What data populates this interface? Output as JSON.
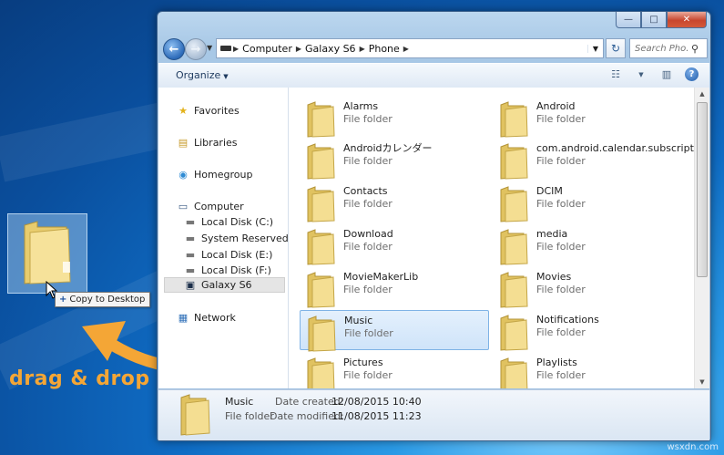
{
  "desktop": {
    "tooltip": "Copy to Desktop",
    "tooltip_icon": "plus-icon",
    "overlay_label": "drag & drop",
    "overlay_color": "#f4a636",
    "watermark": "wsxdn.com"
  },
  "window": {
    "caption_buttons": {
      "minimize": "—",
      "maximize": "□",
      "close": "✕"
    },
    "breadcrumb": [
      "Computer",
      "Galaxy S6",
      "Phone"
    ],
    "search_placeholder": "Search Pho...",
    "toolbar": {
      "organize": "Organize"
    }
  },
  "nav": {
    "favorites": "Favorites",
    "libraries": "Libraries",
    "homegroup": "Homegroup",
    "computer": "Computer",
    "drives": [
      "Local Disk (C:)",
      "System Reserved (D:)",
      "Local Disk (E:)",
      "Local Disk (F:)",
      "Galaxy S6"
    ],
    "network": "Network"
  },
  "folders": [
    {
      "name": "Alarms",
      "type": "File folder"
    },
    {
      "name": "Android",
      "type": "File folder"
    },
    {
      "name": "Androidカレンダー",
      "type": "File folder"
    },
    {
      "name": "com.android.calendar.subscription.a",
      "type": "File folder"
    },
    {
      "name": "Contacts",
      "type": "File folder"
    },
    {
      "name": "DCIM",
      "type": "File folder"
    },
    {
      "name": "Download",
      "type": "File folder"
    },
    {
      "name": "media",
      "type": "File folder"
    },
    {
      "name": "MovieMakerLib",
      "type": "File folder"
    },
    {
      "name": "Movies",
      "type": "File folder"
    },
    {
      "name": "Music",
      "type": "File folder"
    },
    {
      "name": "Notifications",
      "type": "File folder"
    },
    {
      "name": "Pictures",
      "type": "File folder"
    },
    {
      "name": "Playlists",
      "type": "File folder"
    }
  ],
  "selected_folder": "Music",
  "details": {
    "name": "Music",
    "type": "File folder",
    "created_label": "Date created:",
    "created": "12/08/2015 10:40",
    "modified_label": "Date modified:",
    "modified": "11/08/2015 11:23"
  }
}
